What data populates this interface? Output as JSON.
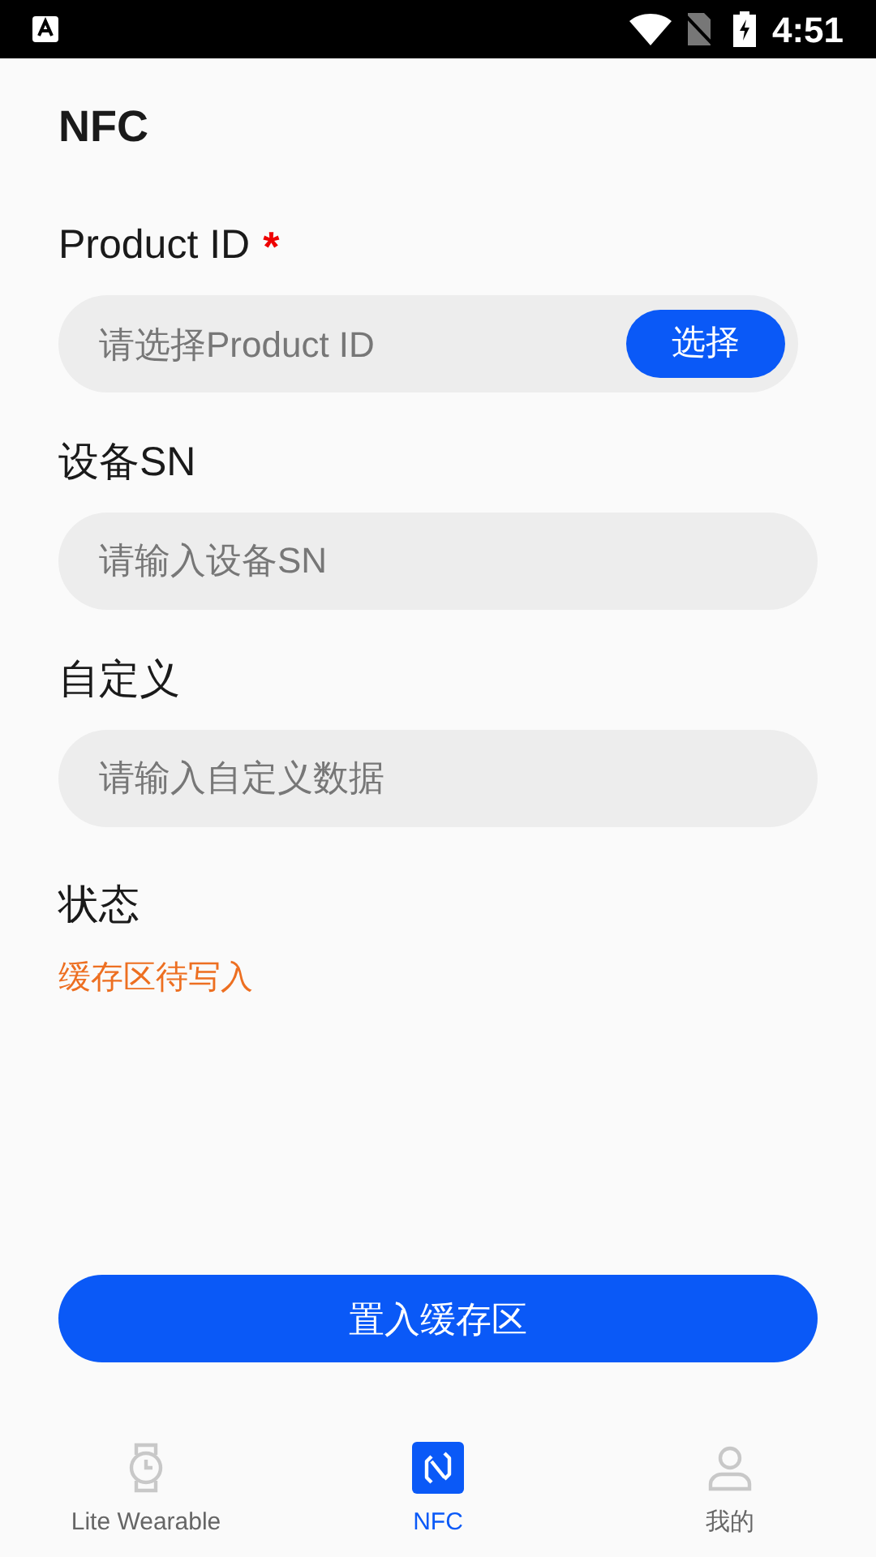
{
  "status_bar": {
    "time": "4:51"
  },
  "title": "NFC",
  "fields": [
    {
      "label": "Product ID",
      "required_mark": "*",
      "placeholder": "请选择Product ID",
      "button": "选择"
    },
    {
      "label": "设备SN",
      "placeholder": "请输入设备SN"
    },
    {
      "label": "自定义",
      "placeholder": "请输入自定义数据"
    }
  ],
  "status": {
    "label": "状态",
    "value": "缓存区待写入"
  },
  "submit_button": "置入缓存区",
  "tabs": [
    {
      "kind": "watch",
      "label": "Lite Wearable",
      "selected": false
    },
    {
      "kind": "nfc",
      "label": "NFC",
      "selected": true
    },
    {
      "kind": "person",
      "label": "我的",
      "selected": false
    }
  ]
}
